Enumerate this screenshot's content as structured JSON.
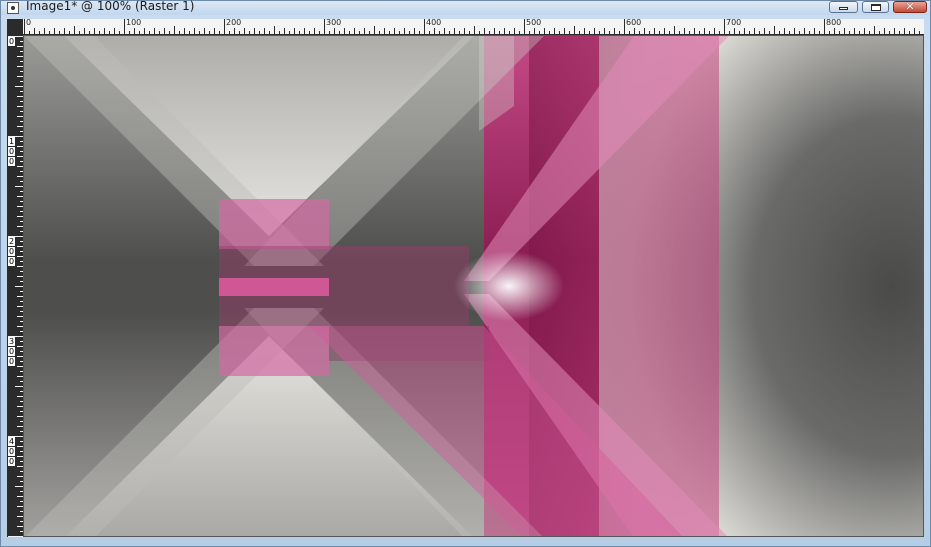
{
  "window": {
    "title": "Image1* @ 100% (Raster 1)",
    "app_icon": "camera-icon",
    "controls": {
      "minimize": "minimize-icon",
      "maximize": "maximize-icon",
      "close": "close-icon"
    }
  },
  "ruler_h": {
    "labels": [
      "0",
      "100",
      "200",
      "300",
      "400",
      "500",
      "600",
      "700",
      "800"
    ]
  },
  "ruler_v": {
    "labels": [
      [
        "0"
      ],
      [
        "1",
        "0",
        "0"
      ],
      [
        "2",
        "0",
        "0"
      ],
      [
        "3",
        "0",
        "0"
      ],
      [
        "4",
        "0",
        "0"
      ]
    ]
  },
  "colors": {
    "pink": "#c73a80",
    "magenta_dark": "#8e1f55",
    "gray_dark": "#555555",
    "gray_light": "#e8e7e2"
  }
}
